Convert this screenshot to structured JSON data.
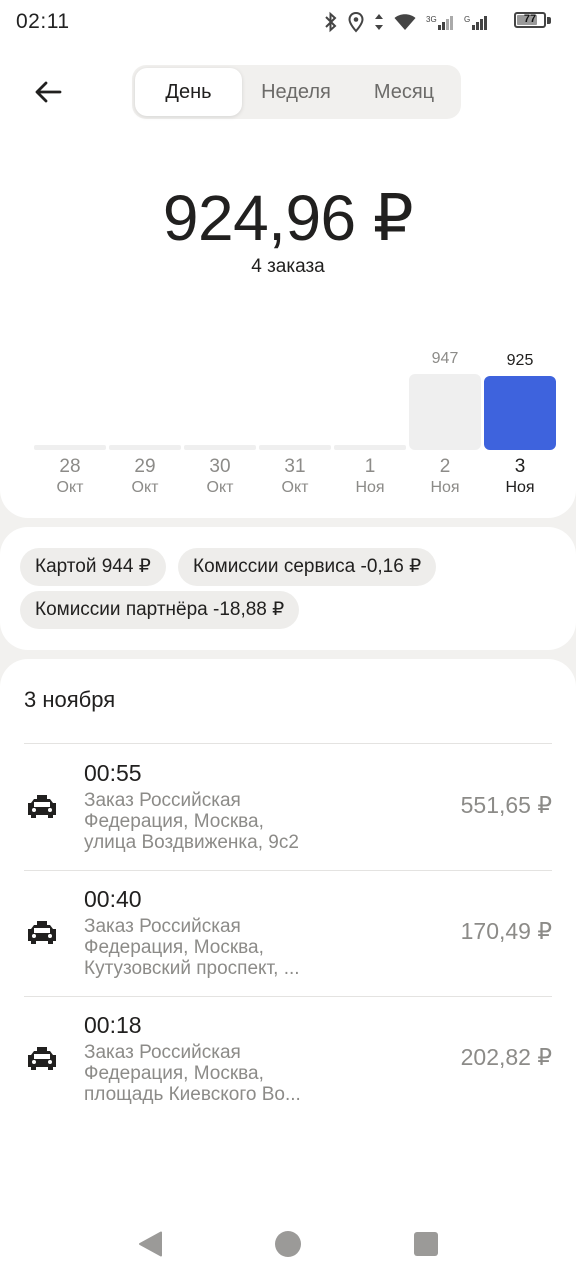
{
  "status_bar": {
    "time": "02:11",
    "battery": "77",
    "battery_level": 0.77,
    "icons": [
      "bluetooth-icon",
      "location-icon",
      "data-arrows-icon",
      "wifi-icon",
      "signal-3g-icon",
      "signal-g-icon",
      "battery-icon"
    ]
  },
  "header": {
    "back_icon": "arrow-left-icon",
    "tabs": [
      {
        "label": "День",
        "active": true
      },
      {
        "label": "Неделя",
        "active": false
      },
      {
        "label": "Месяц",
        "active": false
      }
    ]
  },
  "summary": {
    "total": "924,96 ₽",
    "orders_count": "4 заказа"
  },
  "chart_data": {
    "type": "bar",
    "categories": [
      "28 Окт",
      "29 Окт",
      "30 Окт",
      "31 Окт",
      "1 Ноя",
      "2 Ноя",
      "3 Ноя"
    ],
    "days": [
      "28",
      "29",
      "30",
      "31",
      "1",
      "2",
      "3"
    ],
    "months": [
      "Окт",
      "Окт",
      "Окт",
      "Окт",
      "Ноя",
      "Ноя",
      "Ноя"
    ],
    "values": [
      0,
      0,
      0,
      0,
      0,
      947,
      925
    ],
    "value_labels": [
      "",
      "",
      "",
      "",
      "",
      "947",
      "925"
    ],
    "selected_index": 6,
    "colors": {
      "bar": "#efefef",
      "selected": "#3e63dd"
    }
  },
  "breakdown": {
    "card": "Картой 944 ₽",
    "service_fee": "Комиссии сервиса -0,16 ₽",
    "partner_fee": "Комиссии партнёра -18,88 ₽"
  },
  "orders_section": {
    "date": "3 ноября",
    "orders": [
      {
        "time": "00:55",
        "address_lines": [
          "Заказ Российская",
          "Федерация, Москва,",
          "улица Воздвиженка, 9с2"
        ],
        "price": "551,65 ₽",
        "icon": "taxi-car-icon"
      },
      {
        "time": "00:40",
        "address_lines": [
          "Заказ Российская",
          "Федерация, Москва,",
          "Кутузовский проспект, ..."
        ],
        "price": "170,49 ₽",
        "icon": "taxi-car-icon"
      },
      {
        "time": "00:18",
        "address_lines": [
          "Заказ Российская",
          "Федерация, Москва,",
          "площадь Киевского Во..."
        ],
        "price": "202,82 ₽",
        "icon": "taxi-car-icon"
      }
    ]
  },
  "colors": {
    "accent": "#3e63dd",
    "background": "#f2f1ef",
    "text_primary": "#21201f",
    "text_secondary": "#8c8b88"
  }
}
